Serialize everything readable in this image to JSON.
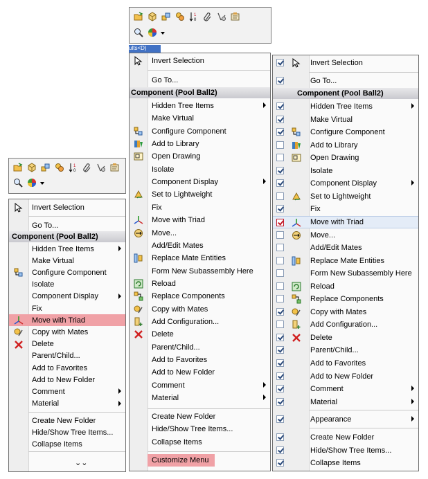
{
  "toolbar_icons": [
    "folder-open-icon",
    "box-icon",
    "assembly-icon",
    "components-icon",
    "sort-icon",
    "paperclip-icon",
    "mate-icon",
    "properties-icon"
  ],
  "toolbar_row2": [
    "zoom-icon",
    "appearance-icon",
    "dropdown-arrow-icon"
  ],
  "blue_tab_text": "ults<D)",
  "menu1": {
    "top_items": [
      {
        "label": "Invert Selection",
        "icon": "cursor-icon"
      },
      {
        "label": "Go To..."
      }
    ],
    "header": "Component (Pool Ball2)",
    "items": [
      {
        "label": "Hidden Tree Items",
        "submenu": true
      },
      {
        "label": "Make Virtual"
      },
      {
        "label": "Configure Component",
        "icon": "configure-icon"
      },
      {
        "label": "Isolate"
      },
      {
        "label": "Component Display",
        "submenu": true
      },
      {
        "label": "Fix"
      },
      {
        "label": "Move with Triad",
        "icon": "triad-icon",
        "highlight": true
      },
      {
        "label": "Copy with Mates",
        "icon": "copy-mates-icon"
      },
      {
        "label": "Delete",
        "icon": "delete-icon"
      },
      {
        "label": "Parent/Child..."
      },
      {
        "label": "Add to Favorites"
      },
      {
        "label": "Add to New Folder"
      },
      {
        "label": "Comment",
        "submenu": true
      },
      {
        "label": "Material",
        "submenu": true
      }
    ],
    "footer": [
      "Create New Folder",
      "Hide/Show Tree Items...",
      "Collapse Items"
    ],
    "more": "⌄⌄"
  },
  "menu2": {
    "top_items": [
      {
        "label": "Invert Selection",
        "icon": "cursor-icon"
      },
      {
        "label": "Go To..."
      }
    ],
    "header": "Component (Pool Ball2)",
    "items": [
      {
        "label": "Hidden Tree Items",
        "submenu": true
      },
      {
        "label": "Make Virtual"
      },
      {
        "label": "Configure Component",
        "icon": "configure-icon"
      },
      {
        "label": "Add to Library",
        "icon": "library-icon"
      },
      {
        "label": "Open Drawing",
        "icon": "drawing-icon"
      },
      {
        "label": "Isolate"
      },
      {
        "label": "Component Display",
        "submenu": true
      },
      {
        "label": "Set to Lightweight",
        "icon": "lightweight-icon"
      },
      {
        "label": "Fix"
      },
      {
        "label": "Move with Triad",
        "icon": "triad-icon"
      },
      {
        "label": "Move...",
        "icon": "move-icon"
      },
      {
        "label": "Add/Edit Mates"
      },
      {
        "label": "Replace Mate Entities",
        "icon": "replace-mate-icon"
      },
      {
        "label": "Form New Subassembly Here"
      },
      {
        "label": "Reload",
        "icon": "reload-icon"
      },
      {
        "label": "Replace Components",
        "icon": "replace-components-icon"
      },
      {
        "label": "Copy with Mates",
        "icon": "copy-mates-icon"
      },
      {
        "label": "Add Configuration...",
        "icon": "add-config-icon"
      },
      {
        "label": "Delete",
        "icon": "delete-icon"
      },
      {
        "label": "Parent/Child..."
      },
      {
        "label": "Add to Favorites"
      },
      {
        "label": "Add to New Folder"
      },
      {
        "label": "Comment",
        "submenu": true
      },
      {
        "label": "Material",
        "submenu": true
      }
    ],
    "footer": [
      "Create New Folder",
      "Hide/Show Tree Items...",
      "Collapse Items"
    ],
    "customize": "Customize Menu"
  },
  "menu3": {
    "top_items": [
      {
        "label": "Invert Selection",
        "icon": "cursor-icon",
        "checked": true
      },
      {
        "label": "Go To...",
        "checked": true
      }
    ],
    "header": "Component (Pool Ball2)",
    "items": [
      {
        "label": "Hidden Tree Items",
        "submenu": true,
        "checked": true
      },
      {
        "label": "Make Virtual",
        "checked": true
      },
      {
        "label": "Configure Component",
        "icon": "configure-icon",
        "checked": true
      },
      {
        "label": "Add to Library",
        "icon": "library-icon",
        "checked": false
      },
      {
        "label": "Open Drawing",
        "icon": "drawing-icon",
        "checked": false
      },
      {
        "label": "Isolate",
        "checked": true
      },
      {
        "label": "Component Display",
        "submenu": true,
        "checked": true
      },
      {
        "label": "Set to Lightweight",
        "icon": "lightweight-icon",
        "checked": false
      },
      {
        "label": "Fix",
        "checked": true
      },
      {
        "label": "Move with Triad",
        "icon": "triad-icon",
        "checked": true,
        "hover": true
      },
      {
        "label": "Move...",
        "icon": "move-icon",
        "checked": false
      },
      {
        "label": "Add/Edit Mates",
        "checked": false
      },
      {
        "label": "Replace Mate Entities",
        "icon": "replace-mate-icon",
        "checked": false
      },
      {
        "label": "Form New Subassembly Here",
        "checked": false
      },
      {
        "label": "Reload",
        "icon": "reload-icon",
        "checked": false
      },
      {
        "label": "Replace Components",
        "icon": "replace-components-icon",
        "checked": false
      },
      {
        "label": "Copy with Mates",
        "icon": "copy-mates-icon",
        "checked": true
      },
      {
        "label": "Add Configuration...",
        "icon": "add-config-icon",
        "checked": false
      },
      {
        "label": "Delete",
        "icon": "delete-icon",
        "checked": true
      },
      {
        "label": "Parent/Child...",
        "checked": true
      },
      {
        "label": "Add to Favorites",
        "checked": true
      },
      {
        "label": "Add to New Folder",
        "checked": true
      },
      {
        "label": "Comment",
        "submenu": true,
        "checked": true
      },
      {
        "label": "Material",
        "submenu": true,
        "checked": true
      }
    ],
    "appearance": {
      "label": "Appearance",
      "checked": true
    },
    "footer": [
      {
        "label": "Create New Folder",
        "checked": true
      },
      {
        "label": "Hide/Show Tree Items...",
        "checked": true
      },
      {
        "label": "Collapse Items",
        "checked": true
      }
    ]
  },
  "colors": {
    "highlight": "#f0a1a6",
    "header": "#c9c9cf",
    "gutter": "#eeeeee",
    "checkbox_red": "#c21a2a"
  }
}
